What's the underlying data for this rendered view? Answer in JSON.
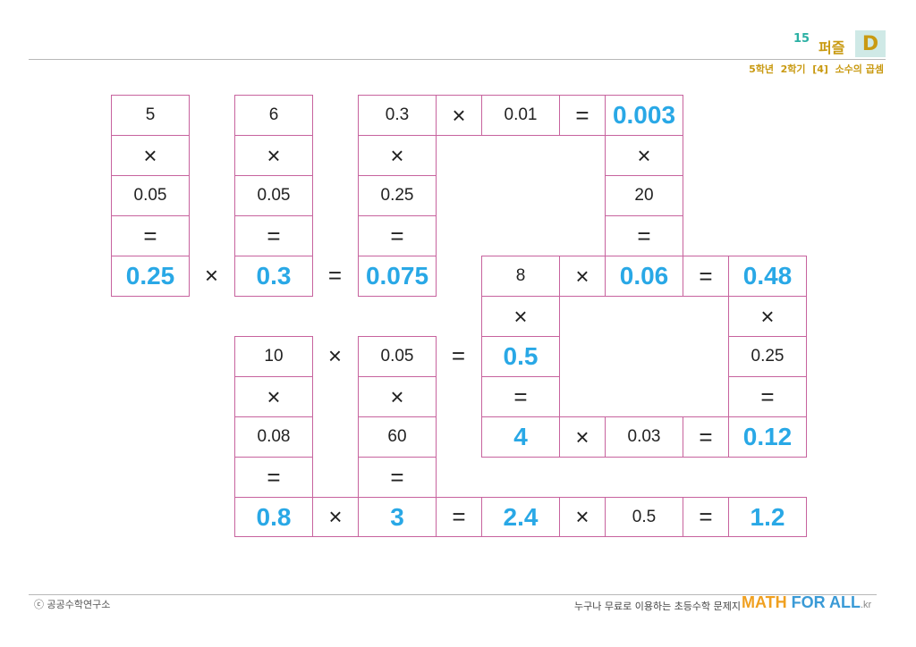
{
  "header": {
    "page_number": "15",
    "puzzle_label": "퍼즐",
    "level": "D",
    "subtitle": "5학년  2학기  [4]  소수의 곱셈"
  },
  "grid": [
    {
      "r": 0,
      "c": 0,
      "text": "5",
      "kind": "num",
      "border": true
    },
    {
      "r": 0,
      "c": 2,
      "text": "6",
      "kind": "num",
      "border": true
    },
    {
      "r": 0,
      "c": 4,
      "text": "0.3",
      "kind": "num",
      "border": true
    },
    {
      "r": 0,
      "c": 5,
      "text": "×",
      "kind": "sym",
      "border": true
    },
    {
      "r": 0,
      "c": 6,
      "text": "0.01",
      "kind": "num",
      "border": true
    },
    {
      "r": 0,
      "c": 7,
      "text": "=",
      "kind": "sym",
      "border": true
    },
    {
      "r": 0,
      "c": 8,
      "text": "0.003",
      "kind": "ans",
      "border": true
    },
    {
      "r": 1,
      "c": 0,
      "text": "×",
      "kind": "sym",
      "border": true
    },
    {
      "r": 1,
      "c": 2,
      "text": "×",
      "kind": "sym",
      "border": true
    },
    {
      "r": 1,
      "c": 4,
      "text": "×",
      "kind": "sym",
      "border": true
    },
    {
      "r": 1,
      "c": 8,
      "text": "×",
      "kind": "sym",
      "border": true
    },
    {
      "r": 2,
      "c": 0,
      "text": "0.05",
      "kind": "num",
      "border": true
    },
    {
      "r": 2,
      "c": 2,
      "text": "0.05",
      "kind": "num",
      "border": true
    },
    {
      "r": 2,
      "c": 4,
      "text": "0.25",
      "kind": "num",
      "border": true
    },
    {
      "r": 2,
      "c": 8,
      "text": "20",
      "kind": "num",
      "border": true
    },
    {
      "r": 3,
      "c": 0,
      "text": "=",
      "kind": "sym",
      "border": true
    },
    {
      "r": 3,
      "c": 2,
      "text": "=",
      "kind": "sym",
      "border": true
    },
    {
      "r": 3,
      "c": 4,
      "text": "=",
      "kind": "sym",
      "border": true
    },
    {
      "r": 3,
      "c": 8,
      "text": "=",
      "kind": "sym",
      "border": true
    },
    {
      "r": 4,
      "c": 0,
      "text": "0.25",
      "kind": "ans",
      "border": true
    },
    {
      "r": 4,
      "c": 1,
      "text": "×",
      "kind": "sym",
      "border": false
    },
    {
      "r": 4,
      "c": 2,
      "text": "0.3",
      "kind": "ans",
      "border": true
    },
    {
      "r": 4,
      "c": 3,
      "text": "=",
      "kind": "sym",
      "border": false
    },
    {
      "r": 4,
      "c": 4,
      "text": "0.075",
      "kind": "ans",
      "border": true
    },
    {
      "r": 4,
      "c": 6,
      "text": "8",
      "kind": "num",
      "border": true
    },
    {
      "r": 4,
      "c": 7,
      "text": "×",
      "kind": "sym",
      "border": true
    },
    {
      "r": 4,
      "c": 8,
      "text": "0.06",
      "kind": "ans",
      "border": true
    },
    {
      "r": 4,
      "c": 9,
      "text": "=",
      "kind": "sym",
      "border": true
    },
    {
      "r": 4,
      "c": 10,
      "text": "0.48",
      "kind": "ans",
      "border": true
    },
    {
      "r": 5,
      "c": 6,
      "text": "×",
      "kind": "sym",
      "border": true
    },
    {
      "r": 5,
      "c": 10,
      "text": "×",
      "kind": "sym",
      "border": true
    },
    {
      "r": 6,
      "c": 2,
      "text": "10",
      "kind": "num",
      "border": true
    },
    {
      "r": 6,
      "c": 3,
      "text": "×",
      "kind": "sym",
      "border": false
    },
    {
      "r": 6,
      "c": 4,
      "text": "0.05",
      "kind": "num",
      "border": true
    },
    {
      "r": 6,
      "c": 5,
      "text": "=",
      "kind": "sym",
      "border": false
    },
    {
      "r": 6,
      "c": 6,
      "text": "0.5",
      "kind": "ans",
      "border": true
    },
    {
      "r": 6,
      "c": 10,
      "text": "0.25",
      "kind": "num",
      "border": true
    },
    {
      "r": 7,
      "c": 2,
      "text": "×",
      "kind": "sym",
      "border": true
    },
    {
      "r": 7,
      "c": 4,
      "text": "×",
      "kind": "sym",
      "border": true
    },
    {
      "r": 7,
      "c": 6,
      "text": "=",
      "kind": "sym",
      "border": true
    },
    {
      "r": 7,
      "c": 10,
      "text": "=",
      "kind": "sym",
      "border": true
    },
    {
      "r": 8,
      "c": 2,
      "text": "0.08",
      "kind": "num",
      "border": true
    },
    {
      "r": 8,
      "c": 4,
      "text": "60",
      "kind": "num",
      "border": true
    },
    {
      "r": 8,
      "c": 6,
      "text": "4",
      "kind": "ans",
      "border": true
    },
    {
      "r": 8,
      "c": 7,
      "text": "×",
      "kind": "sym",
      "border": true
    },
    {
      "r": 8,
      "c": 8,
      "text": "0.03",
      "kind": "num",
      "border": true
    },
    {
      "r": 8,
      "c": 9,
      "text": "=",
      "kind": "sym",
      "border": true
    },
    {
      "r": 8,
      "c": 10,
      "text": "0.12",
      "kind": "ans",
      "border": true
    },
    {
      "r": 9,
      "c": 2,
      "text": "=",
      "kind": "sym",
      "border": true
    },
    {
      "r": 9,
      "c": 4,
      "text": "=",
      "kind": "sym",
      "border": true
    },
    {
      "r": 10,
      "c": 2,
      "text": "0.8",
      "kind": "ans",
      "border": true
    },
    {
      "r": 10,
      "c": 3,
      "text": "×",
      "kind": "sym",
      "border": true
    },
    {
      "r": 10,
      "c": 4,
      "text": "3",
      "kind": "ans",
      "border": true
    },
    {
      "r": 10,
      "c": 5,
      "text": "=",
      "kind": "sym",
      "border": true
    },
    {
      "r": 10,
      "c": 6,
      "text": "2.4",
      "kind": "ans",
      "border": true
    },
    {
      "r": 10,
      "c": 7,
      "text": "×",
      "kind": "sym",
      "border": true
    },
    {
      "r": 10,
      "c": 8,
      "text": "0.5",
      "kind": "num",
      "border": true
    },
    {
      "r": 10,
      "c": 9,
      "text": "=",
      "kind": "sym",
      "border": true
    },
    {
      "r": 10,
      "c": 10,
      "text": "1.2",
      "kind": "ans",
      "border": true
    }
  ],
  "footer": {
    "copyright": "ⓒ 공공수학연구소",
    "slogan": "누구나 무료로 이용하는 초등수학 문제지",
    "brand_math": "MATH",
    "brand_forall": "FOR ALL",
    "brand_kr": ".kr"
  },
  "colors": {
    "border": "#c7639e",
    "answer": "#29a8e6",
    "gold": "#c99a12",
    "teal": "#2bb0a4"
  }
}
